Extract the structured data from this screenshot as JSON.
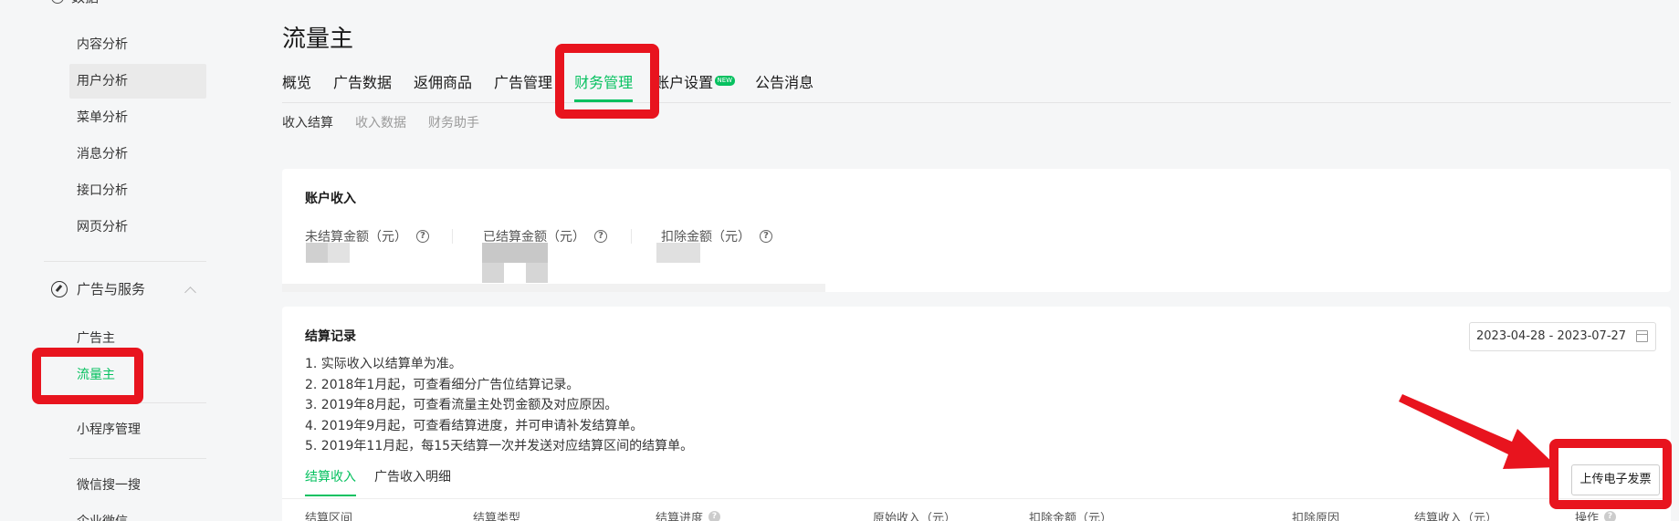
{
  "sidebar": {
    "top_group": "数据",
    "data_items": [
      "内容分析",
      "用户分析",
      "菜单分析",
      "消息分析",
      "接口分析",
      "网页分析"
    ],
    "section": "广告与服务",
    "ad_items": [
      "广告主",
      "流量主"
    ],
    "other_items": [
      "小程序管理",
      "微信搜一搜",
      "企业微信"
    ]
  },
  "page": {
    "title": "流量主",
    "tabs": [
      "概览",
      "广告数据",
      "返佣商品",
      "广告管理",
      "财务管理",
      "账户设置",
      "公告消息"
    ],
    "new_badge": "NEW",
    "subtabs": [
      "收入结算",
      "收入数据",
      "财务助手"
    ]
  },
  "account": {
    "title": "账户收入",
    "metrics": [
      "未结算金额（元）",
      "已结算金额（元）",
      "扣除金额（元）"
    ]
  },
  "settlement": {
    "title": "结算记录",
    "notes": [
      "1. 实际收入以结算单为准。",
      "2. 2018年1月起，可查看细分广告位结算记录。",
      "3. 2019年8月起，可查看流量主处罚金额及对应原因。",
      "4. 2019年9月起，可查看结算进度，并可申请补发结算单。",
      "5. 2019年11月起，每15天结算一次并发送对应结算区间的结算单。"
    ],
    "date_range": "2023-04-28 - 2023-07-27",
    "tabs": [
      "结算收入",
      "广告收入明细"
    ],
    "upload_button": "上传电子发票",
    "columns": [
      "结算区间",
      "结算类型",
      "结算进度",
      "原始收入（元）",
      "扣除金额（元）",
      "扣除原因",
      "结算收入（元）",
      "操作"
    ]
  },
  "colors": {
    "accent": "#07c160",
    "annotation": "#e8141e"
  }
}
